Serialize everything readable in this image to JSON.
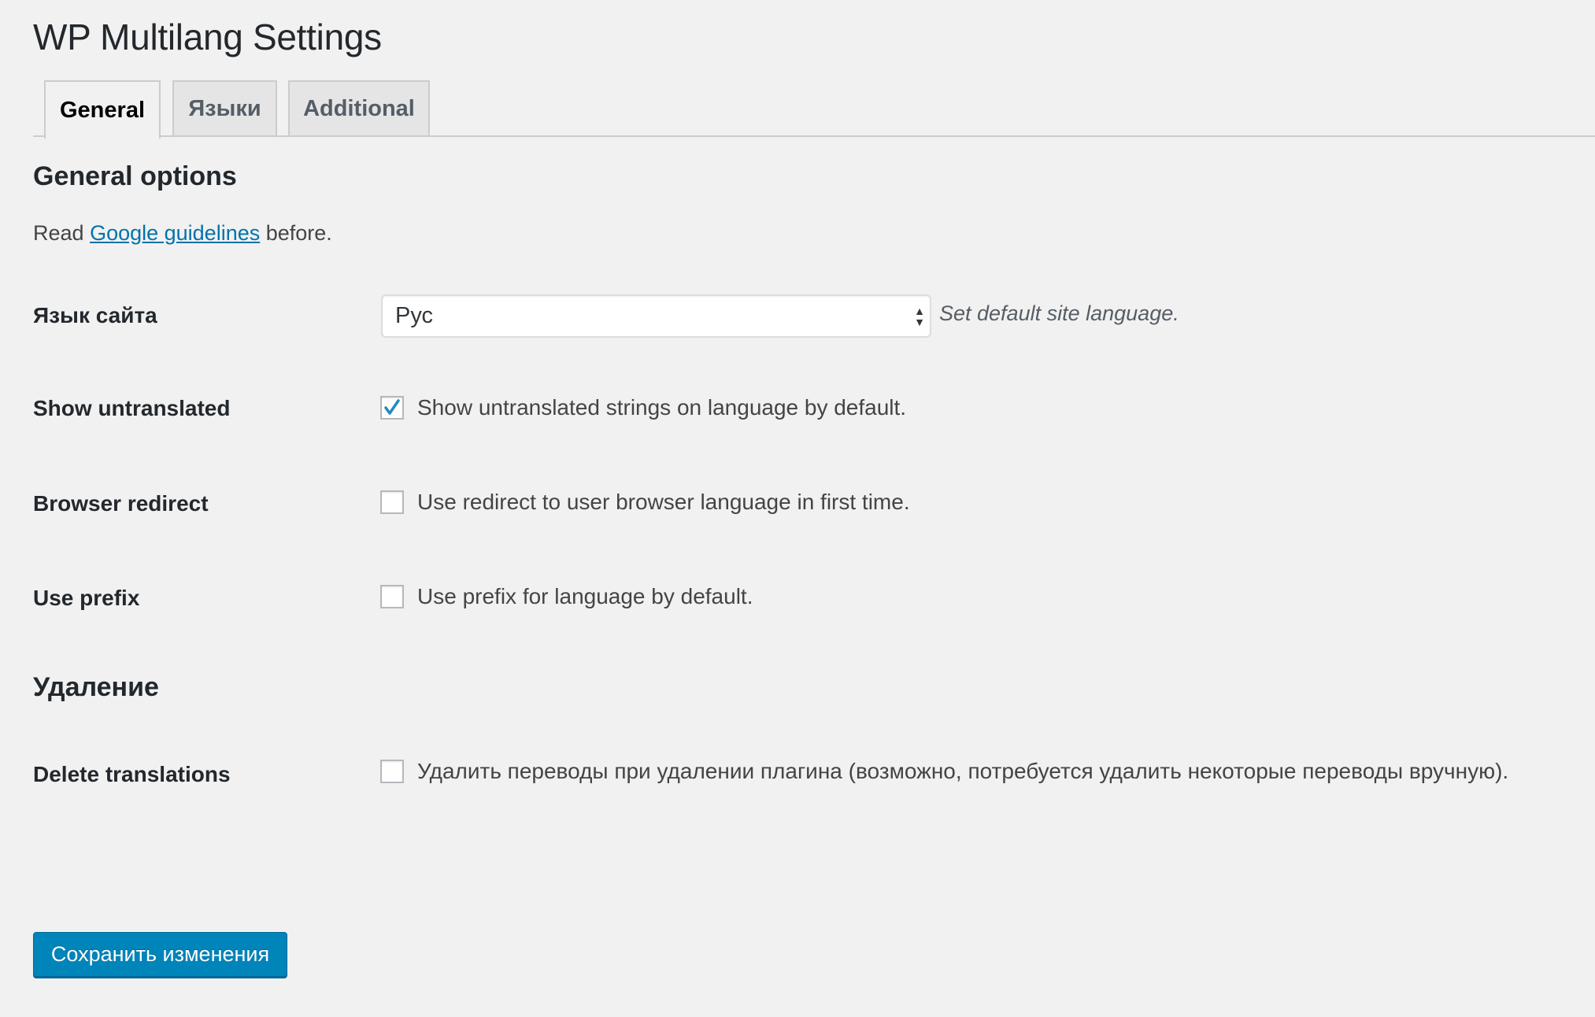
{
  "page": {
    "title": "WP Multilang Settings"
  },
  "tabs": [
    {
      "label": "General",
      "active": true
    },
    {
      "label": "Языки",
      "active": false
    },
    {
      "label": "Additional",
      "active": false
    }
  ],
  "general_section": {
    "heading": "General options",
    "intro_prefix": "Read ",
    "intro_link": "Google guidelines",
    "intro_suffix": " before."
  },
  "fields": {
    "site_language": {
      "label": "Язык сайта",
      "selected": "Рус",
      "description": "Set default site language."
    },
    "show_untranslated": {
      "label": "Show untranslated",
      "checked": true,
      "text": "Show untranslated strings on language by default."
    },
    "browser_redirect": {
      "label": "Browser redirect",
      "checked": false,
      "text": "Use redirect to user browser language in first time."
    },
    "use_prefix": {
      "label": "Use prefix",
      "checked": false,
      "text": "Use prefix for language by default."
    }
  },
  "deletion_section": {
    "heading": "Удаление",
    "delete_translations": {
      "label": "Delete translations",
      "checked": false,
      "text": "Удалить переводы при удалении плагина (возможно, потребуется удалить некоторые переводы вручную)."
    }
  },
  "actions": {
    "save_label": "Сохранить изменения"
  },
  "colors": {
    "accent": "#0085ba",
    "link": "#0073aa",
    "background": "#f1f1f1",
    "check": "#1e8cbe"
  }
}
